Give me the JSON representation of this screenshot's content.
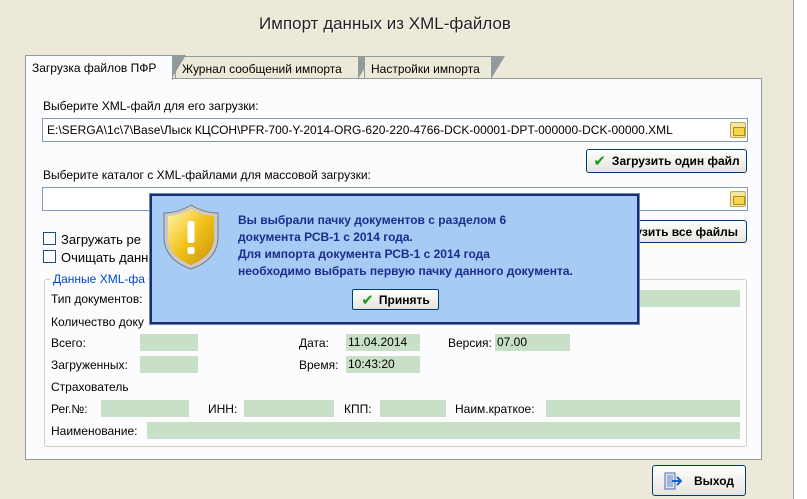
{
  "window": {
    "title": "Импорт данных из XML-файлов"
  },
  "tabs": [
    {
      "label": "Загрузка файлов ПФР"
    },
    {
      "label": "Журнал сообщений импорта"
    },
    {
      "label": "Настройки импорта"
    }
  ],
  "single": {
    "label": "Выберите XML-файл для его загрузки:",
    "path": "E:\\SERGA\\1c\\7\\Base\\Лыск КЦСОН\\PFR-700-Y-2014-ORG-620-220-4766-DCK-00001-DPT-000000-DCK-00000.XML",
    "button": "Загрузить один файл"
  },
  "batch": {
    "label": "Выберите каталог с XML-файлами для массовой загрузки:",
    "path": "",
    "button_visible": "узить все файлы"
  },
  "options": [
    {
      "label": "Загружать ре",
      "checked": false
    },
    {
      "label": "Очищать данн",
      "checked": false
    }
  ],
  "group": {
    "legend": "Данные XML-фа",
    "doc_type_label": "Тип документов:",
    "count_label": "Количество доку",
    "total_label": "Всего:",
    "loaded_label": "Загруженных:",
    "date_label": "Дата:",
    "date_value": "11.04.2014",
    "time_label": "Время:",
    "time_value": "10:43:20",
    "version_label": "Версия:",
    "version_value": "07.00",
    "insurer_label": "Страхователь",
    "reg_label": "Рег.№:",
    "inn_label": "ИНН:",
    "kpp_label": "КПП:",
    "short_name_label": "Наим.краткое:",
    "name_label": "Наименование:"
  },
  "dialog": {
    "line1": "Вы выбрали пачку документов с разделом 6",
    "line2": "документа РСВ-1 с 2014 года.",
    "line3": "Для импорта документа РСВ-1 с 2014 года",
    "line4": "необходимо выбрать первую пачку данного документа.",
    "ok": "Принять"
  },
  "exit_button": "Выход",
  "colors": {
    "dialog_bg": "#a6cbf5",
    "dialog_text": "#1c2c8c",
    "data_fill": "#c8dfc8",
    "legend": "#0046d5"
  }
}
